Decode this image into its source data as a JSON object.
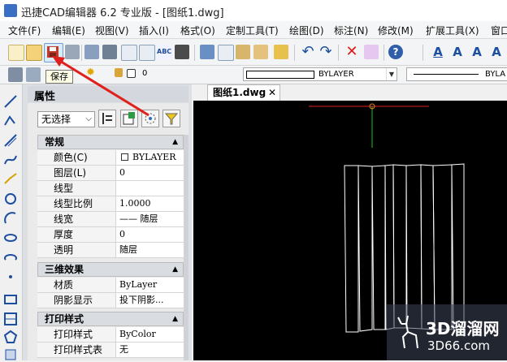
{
  "window": {
    "title": "迅捷CAD编辑器 6.2 专业版 - [图纸1.dwg]"
  },
  "menu": [
    "文件(F)",
    "编辑(E)",
    "视图(V)",
    "插入(I)",
    "格式(O)",
    "定制工具(T)",
    "绘图(D)",
    "标注(N)",
    "修改(M)",
    "扩展工具(X)",
    "窗口"
  ],
  "tooltip": {
    "text": "保存"
  },
  "layer_bar": {
    "layer_value": "0",
    "color_value": "BYLAYER",
    "linetype_value": "BYLA"
  },
  "properties": {
    "title": "属性",
    "selection": "无选择",
    "sections": [
      {
        "name": "常规",
        "rows": [
          {
            "key": "颜色(C)",
            "value": "BYLAYER"
          },
          {
            "key": "图层(L)",
            "value": "0"
          },
          {
            "key": "线型",
            "value": ""
          },
          {
            "key": "线型比例",
            "value": "1.0000"
          },
          {
            "key": "线宽",
            "value": "—— 随层"
          },
          {
            "key": "厚度",
            "value": "0"
          },
          {
            "key": "透明",
            "value": "随层"
          }
        ]
      },
      {
        "name": "三维效果",
        "rows": [
          {
            "key": "材质",
            "value": "ByLayer"
          },
          {
            "key": "阴影显示",
            "value": "投下阴影..."
          }
        ]
      },
      {
        "name": "打印样式",
        "rows": [
          {
            "key": "打印样式",
            "value": "ByColor"
          },
          {
            "key": "打印样式表",
            "value": "无"
          }
        ]
      }
    ]
  },
  "document": {
    "tab_label": "图纸1.dwg",
    "close_label": "✕"
  },
  "watermark": {
    "big": "3D溜溜网",
    "small": "3D66.com"
  },
  "colors": {
    "arrow": "#e0201c",
    "canvas": "#000000",
    "accent": "#3a6fc4"
  }
}
